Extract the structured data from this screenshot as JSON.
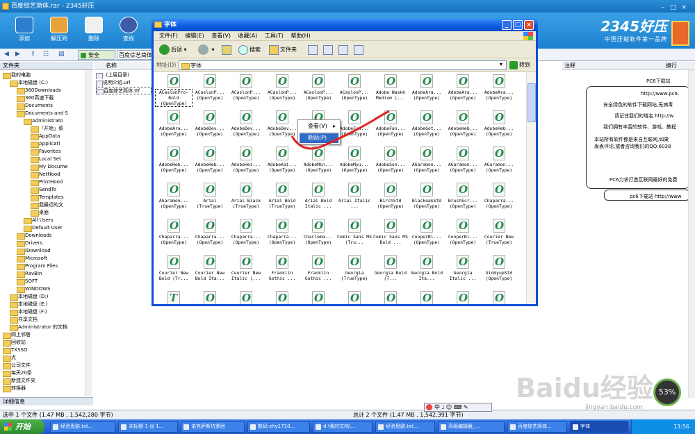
{
  "app": {
    "title": "百度综艺简体.rar - 2345好压",
    "toolbar": [
      {
        "label": "添加",
        "icon": "add-archive-icon",
        "color": "#2f7fd1"
      },
      {
        "label": "解压到",
        "icon": "extract-icon",
        "color": "#e8a23a"
      },
      {
        "label": "删除",
        "icon": "delete-icon",
        "color": "#f0f0f0"
      },
      {
        "label": "查找",
        "icon": "search-icon",
        "color": "#3d5ca8"
      }
    ],
    "brand": {
      "name": "2345好压",
      "slogan": "中国压缩软件第一品牌"
    },
    "safe_label": "安全",
    "path": "百度综艺简体",
    "accent": "#1d80cf"
  },
  "tree": {
    "header": "文件夹",
    "items": [
      {
        "label": "我的电脑",
        "indent": 1
      },
      {
        "label": "本地磁盘 (C:)",
        "indent": 2
      },
      {
        "label": "360Downloads",
        "indent": 3
      },
      {
        "label": "360高速下载",
        "indent": 3
      },
      {
        "label": "Documents",
        "indent": 3
      },
      {
        "label": "Documents and S",
        "indent": 3
      },
      {
        "label": "Administrato",
        "indent": 4
      },
      {
        "label": "「开始」菜",
        "indent": 5
      },
      {
        "label": "AppData",
        "indent": 5
      },
      {
        "label": "Applicati",
        "indent": 5
      },
      {
        "label": "Favorites",
        "indent": 5
      },
      {
        "label": "Local Set",
        "indent": 5
      },
      {
        "label": "My Docume",
        "indent": 5
      },
      {
        "label": "NetHood",
        "indent": 5
      },
      {
        "label": "PrintHood",
        "indent": 5
      },
      {
        "label": "SendTo",
        "indent": 5
      },
      {
        "label": "Templates",
        "indent": 5
      },
      {
        "label": "我最近的文",
        "indent": 5
      },
      {
        "label": "桌面",
        "indent": 5
      },
      {
        "label": "All Users",
        "indent": 4
      },
      {
        "label": "Default User",
        "indent": 4
      },
      {
        "label": "Downloads",
        "indent": 3
      },
      {
        "label": "Drivers",
        "indent": 3
      },
      {
        "label": "iDownload",
        "indent": 3
      },
      {
        "label": "Microsoft",
        "indent": 3
      },
      {
        "label": "Program Files",
        "indent": 3
      },
      {
        "label": "RavBin",
        "indent": 3
      },
      {
        "label": "SOFT",
        "indent": 3
      },
      {
        "label": "WINDOWS",
        "indent": 3
      },
      {
        "label": "本地磁盘 (D:)",
        "indent": 2
      },
      {
        "label": "本地磁盘 (E:)",
        "indent": 2
      },
      {
        "label": "本地磁盘 (F:)",
        "indent": 2
      },
      {
        "label": "共享文档",
        "indent": 2
      },
      {
        "label": "Administrator 的文档",
        "indent": 2
      },
      {
        "label": "网上邻居",
        "indent": 1
      },
      {
        "label": "回收站",
        "indent": 1
      },
      {
        "label": "TXSSO",
        "indent": 1
      },
      {
        "label": "点",
        "indent": 1
      },
      {
        "label": "公司文件",
        "indent": 1
      },
      {
        "label": "每天20条",
        "indent": 1
      },
      {
        "label": "新建文件夹",
        "indent": 1
      },
      {
        "label": "转换器",
        "indent": 1
      }
    ],
    "detail_label": "详细信息"
  },
  "list": {
    "header": "名称",
    "items": [
      "..(上层目录)",
      "说明介绍.url",
      "百度综艺简体.ttf"
    ]
  },
  "note": {
    "header": "注释",
    "wrap_label": "换行",
    "lines": [
      "PC6下载站",
      "http://www.pc6.",
      "安全绿色的软件下载网站,无病毒",
      "请记住我们的域名 http://w",
      "我们拥有丰富的软件、游戏、教程",
      "本站所有软件都是来自互联网,如果",
      "发表评论,或者咨询我们的QQ:6038",
      "PC6力求打造互联网最好的免费",
      "pc6下载站 http://www"
    ]
  },
  "status": {
    "left": "选中 1 个文件 (1.47 MB , 1,542,280 字节)",
    "right": "总计 2 个文件 (1.47 MB , 1,542,391 字节)"
  },
  "ime": {
    "label": "中"
  },
  "taskbar": {
    "start": "开始",
    "items": [
      "经验思路.txt...",
      "未标题-1 @ 1...",
      "诺克萨斯坑爹团",
      "数码-zhy1710...",
      "d:\\我的文档\\...",
      "经验思路.txt...",
      "高级编辑器_...",
      "百度综艺简体...",
      "字体"
    ],
    "clock": "13:56"
  },
  "explorer": {
    "title": "字体",
    "menu": [
      "文件(F)",
      "编辑(E)",
      "查看(V)",
      "收藏(A)",
      "工具(T)",
      "帮助(H)"
    ],
    "back_label": "后退",
    "search_label": "搜索",
    "folders_label": "文件夹",
    "address_label": "地址(D)",
    "address_value": "字体",
    "go_label": "转到",
    "fonts": [
      [
        "ACaslonPro-Bold (OpenType)",
        "ACaslonP... (OpenType)",
        "ACaslonP... (OpenType)",
        "ACaslonP... (OpenType)",
        "ACaslonP... (OpenType)",
        "ACaslonP... (OpenType)",
        "Adobe Naskh Medium (...",
        "AdobeAra... (OpenType)",
        "AdobeAra... (OpenType)",
        "AdobeAra... (OpenType)"
      ],
      [
        "AdobeAra... (OpenType)",
        "AdobeDev... (OpenType)",
        "AdobeDev... (OpenType)",
        "AdobeDev... (OpenType)",
        "AdobeDev... (OpenType)",
        "AdobeFan... (OpenType)",
        "AdobeFan... (OpenType)",
        "AdobeGot... (OpenType)",
        "AdobeHeb... (OpenType)",
        "AdobeHeb... (OpenType)"
      ],
      [
        "AdobeHeb... (OpenType)",
        "AdobeHeb... (OpenType)",
        "AdobeHei... (OpenType)",
        "AdobeKai... (OpenType)",
        "AdobeMin... (OpenType)",
        "AdobeMyu... (OpenType)",
        "AdobeSon... (OpenType)",
        "AGaramon... (OpenType)",
        "AGaramon... (OpenType)",
        "AGaramon... (OpenType)"
      ],
      [
        "AGaramon... (OpenType)",
        "Arial (TrueType)",
        "Arial Black (TrueType)",
        "Arial Bold (TrueType)",
        "Arial Bold Italic ...",
        "Arial Italic ...",
        "BirchStd (OpenType)",
        "BlackoakStd (OpenType)",
        "BrushScr... (OpenType)",
        "Chaparra... (OpenType)"
      ],
      [
        "Chaparra... (OpenType)",
        "Chaparra... (OpenType)",
        "Chaparra... (OpenType)",
        "Chaparra... (OpenType)",
        "Charlema... (OpenType)",
        "Comic Sans MS (Tru...",
        "Comic Sans MS Bold ...",
        "CooperBl... (OpenType)",
        "CooperBl... (OpenType)",
        "Courier New (TrueType)"
      ],
      [
        "Courier New Bold (Tr...",
        "Courier New Bold Ita...",
        "Courier New Italic (...",
        "Franklin Gothic ...",
        "Franklin Gothic ...",
        "Georgia (TrueType)",
        "Georgia Bold (T...",
        "Georgia Bold Ita...",
        "Georgia Italic ...",
        "GiddyupStd (OpenType)"
      ]
    ],
    "context_menu": [
      {
        "label": "查看(V)"
      },
      {
        "label": "粘贴(P)"
      }
    ]
  },
  "watermark": {
    "text": "Baidu经验",
    "url": "jingyan.baidu.com",
    "badge": "53%"
  }
}
